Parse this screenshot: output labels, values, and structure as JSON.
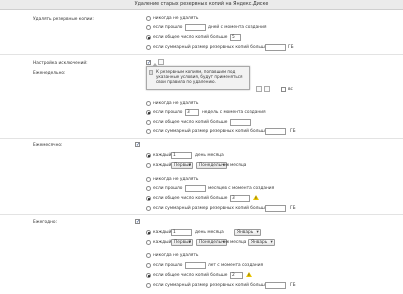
{
  "header": {
    "title": "Удаление старых резервных копий на Яндекс.Диске"
  },
  "delete_backups": {
    "label": "Удалять резервные копии:",
    "never": "никогда не удалять",
    "if_passed": "если прошло",
    "days_since": "дней с момента создания",
    "days_value": "",
    "if_count": "если общее число копий больше",
    "count_value": "5",
    "if_size": "если суммарный размер резервных копий больше",
    "size_value": "",
    "gb": "ГБ"
  },
  "exceptions": {
    "label": "Настройка исключений:",
    "weekly_label": "Еженедельно:",
    "weekday_short": "вс",
    "tooltip": "К резервным копиям, попавшим под указанные условия, будут применяться свои правила по удалению.",
    "never": "никогда не удалять",
    "if_passed": "если прошло",
    "weeks_value": "3",
    "weeks_since": "недель с момента создания",
    "if_count": "если общее число копий больше",
    "count_value": "",
    "if_size": "если суммарный размер резервных копий больше",
    "size_value": "",
    "gb": "ГБ"
  },
  "monthly": {
    "label": "Ежемесячно:",
    "every": "каждый",
    "day_value": "1",
    "day_of_month": "день месяца",
    "every2": "каждый",
    "ordinal": "Первый",
    "weekday": "Понедельник",
    "of_month": "месяца",
    "never": "никогда не удалять",
    "if_passed": "если прошло",
    "months_value": "",
    "months_since": "месяцев с момента создания",
    "if_count": "если общее число копий больше",
    "count_value": "3",
    "if_size": "если суммарный размер резервных копий больше",
    "size_value": "",
    "gb": "ГБ"
  },
  "yearly": {
    "label": "Ежегодно:",
    "every": "каждый",
    "day_value": "1",
    "day_of_month": "день месяца",
    "month1": "Январь",
    "every2": "каждый",
    "ordinal": "Первый",
    "weekday": "Понедельник",
    "of_month": "месяца",
    "month2": "Январь",
    "never": "никогда не удалять",
    "if_passed": "если прошло",
    "years_value": "",
    "years_since": "лет с момента создания",
    "if_count": "если общее число копий больше",
    "count_value": "2",
    "if_size": "если суммарный размер резервных копий больше",
    "size_value": "",
    "gb": "ГБ"
  },
  "colors": {
    "warning": "#e9c400",
    "header_bg": "#ebebeb"
  }
}
